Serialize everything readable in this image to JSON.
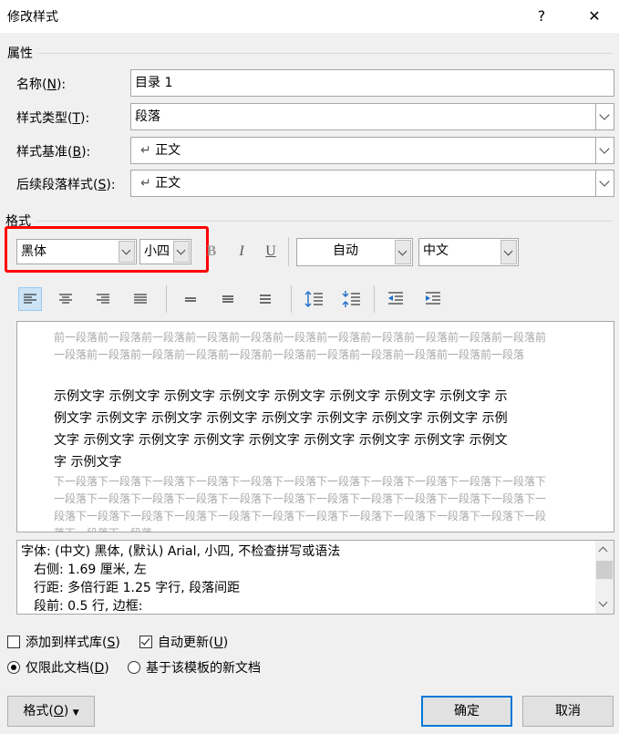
{
  "window": {
    "title": "修改样式",
    "help": "?",
    "close": "✕"
  },
  "properties": {
    "section_label": "属性",
    "name_label": "名称(N):",
    "name_value": "目录 1",
    "style_type_label": "样式类型(T):",
    "style_type_value": "段落",
    "based_on_label": "样式基准(B):",
    "based_on_value": "正文",
    "following_label": "后续段落样式(S):",
    "following_value": "正文",
    "paragraph_mark": "↵"
  },
  "format": {
    "section_label": "格式",
    "font": "黑体",
    "size": "小四",
    "bold": "B",
    "italic": "I",
    "underline": "U",
    "color": "自动",
    "script": "中文",
    "highlight_color": "#ff0000"
  },
  "preview": {
    "before_text": "前一段落前一段落前一段落前一段落前一段落前一段落前一段落前一段落前一段落前一段落前一段落前一段落前一段落前一段落前一段落前一段落前一段落前一段落前一段落前一段落前一段落前一段落",
    "sample_text": "示例文字 示例文字 示例文字 示例文字 示例文字 示例文字 示例文字 示例文字 示例文字 示例文字 示例文字 示例文字 示例文字 示例文字 示例文字 示例文字 示例文字 示例文字 示例文字 示例文字 示例文字 示例文字 示例文字 示例文字 示例文字 示例文字",
    "after_text": "下一段落下一段落下一段落下一段落下一段落下一段落下一段落下一段落下一段落下一段落下一段落下一段落下一段落下一段落下一段落下一段落下一段落下一段落下一段落下一段落下一段落下一段落下一段落下一段落下一段落下一段落下一段落下一段落下一段落下一段落下一段落下一段落下一段落下一段落下一段落下一段落"
  },
  "description": {
    "line1": "字体: (中文) 黑体, (默认) Arial, 小四, 不检查拼写或语法",
    "line2": "右侧:  1.69 厘米, 左",
    "line3": "行距: 多倍行距 1.25 字行, 段落间距",
    "line4": "段前: 0.5 行, 边框:"
  },
  "options": {
    "add_to_gallery": "添加到样式库(S)",
    "add_to_gallery_checked": false,
    "auto_update": "自动更新(U)",
    "auto_update_checked": true,
    "only_this_doc": "仅限此文档(D)",
    "only_this_doc_selected": true,
    "new_docs_template": "基于该模板的新文档",
    "new_docs_template_selected": false
  },
  "buttons": {
    "format": "格式(O)",
    "ok": "确定",
    "cancel": "取消"
  }
}
